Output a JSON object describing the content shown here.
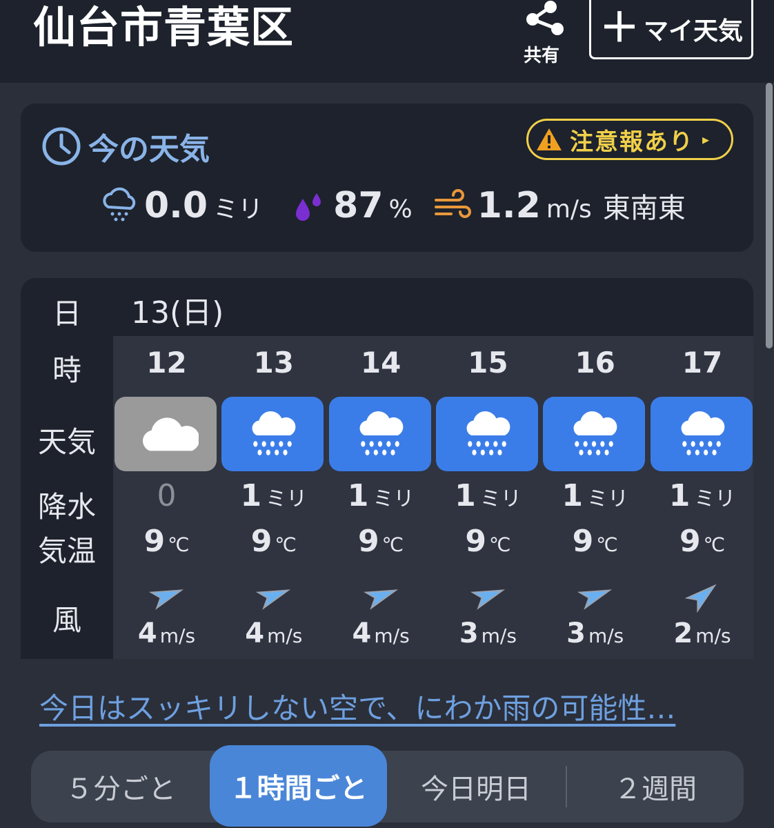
{
  "header": {
    "title": "仙台市青葉区",
    "share_label": "共有",
    "my_weather_plus": "＋",
    "my_weather_label": "マイ天気"
  },
  "now": {
    "title": "今の天気",
    "alert_label": "注意報あり",
    "precip_value": "0.0",
    "precip_unit": "ミリ",
    "humidity_value": "87",
    "humidity_unit": "%",
    "wind_value": "1.2",
    "wind_unit": "m/s",
    "wind_direction": "東南東",
    "icons": [
      "clock-icon",
      "warning-icon",
      "rain-cloud-icon",
      "humidity-drops-icon",
      "wind-icon"
    ]
  },
  "hourly": {
    "labels": {
      "day": "日",
      "hour": "時",
      "weather": "天気",
      "precip": "降水",
      "temp": "気温",
      "wind": "風"
    },
    "date": "13(日)",
    "columns": [
      {
        "hour": "12",
        "weather": "cloudy",
        "precip": "0",
        "precip_unit": "",
        "temp": "9",
        "temp_unit": "℃",
        "wind_speed": "4",
        "wind_unit": "m/s",
        "wind_dir": "northwest"
      },
      {
        "hour": "13",
        "weather": "rain",
        "precip": "1",
        "precip_unit": "ミリ",
        "temp": "9",
        "temp_unit": "℃",
        "wind_speed": "4",
        "wind_unit": "m/s",
        "wind_dir": "northwest"
      },
      {
        "hour": "14",
        "weather": "rain",
        "precip": "1",
        "precip_unit": "ミリ",
        "temp": "9",
        "temp_unit": "℃",
        "wind_speed": "4",
        "wind_unit": "m/s",
        "wind_dir": "northwest"
      },
      {
        "hour": "15",
        "weather": "rain",
        "precip": "1",
        "precip_unit": "ミリ",
        "temp": "9",
        "temp_unit": "℃",
        "wind_speed": "3",
        "wind_unit": "m/s",
        "wind_dir": "northwest"
      },
      {
        "hour": "16",
        "weather": "rain",
        "precip": "1",
        "precip_unit": "ミリ",
        "temp": "9",
        "temp_unit": "℃",
        "wind_speed": "3",
        "wind_unit": "m/s",
        "wind_dir": "northwest"
      },
      {
        "hour": "17",
        "weather": "rain",
        "precip": "1",
        "precip_unit": "ミリ",
        "temp": "9",
        "temp_unit": "℃",
        "wind_speed": "2",
        "wind_unit": "m/s",
        "wind_dir": "west-northwest"
      }
    ]
  },
  "summary_link": "今日はスッキリしない空で、にわか雨の可能性…",
  "tabs": [
    {
      "label": "５分ごと",
      "active": false
    },
    {
      "label": "１時間ごと",
      "active": true
    },
    {
      "label": "今日明日",
      "active": false
    },
    {
      "label": "２週間",
      "active": false
    }
  ],
  "colors": {
    "background": "#2b2f3a",
    "header": "#1d222c",
    "accent_blue": "#4a86d8",
    "rain_tile": "#3b7de8",
    "cloud_tile": "#9a9a9a",
    "alert_yellow": "#f0d04a",
    "title_blue": "#8ab4e8",
    "link_blue": "#6ea0e0"
  }
}
